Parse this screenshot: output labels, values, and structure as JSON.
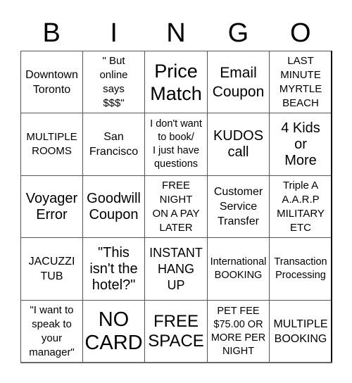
{
  "header": {
    "letters": [
      "B",
      "I",
      "N",
      "G",
      "O"
    ]
  },
  "board": {
    "cells": [
      [
        "Downtown\nToronto",
        "\" But\nonline\nsays\n$$$\"",
        "Price\nMatch",
        "Email\nCoupon",
        "LAST\nMINUTE\nMYRTLE\nBEACH"
      ],
      [
        "MULTIPLE\nROOMS",
        "San\nFrancisco",
        "I don't want\nto book/\nI just have\nquestions",
        "KUDOS\ncall",
        "4 Kids\nor\nMore"
      ],
      [
        "Voyager\nError",
        "Goodwill\nCoupon",
        "FREE\nNIGHT\nON A PAY\nLATER",
        "Customer\nService\nTransfer",
        "Triple A\nA.A.R.P\nMILITARY\nETC"
      ],
      [
        "JACUZZI\nTUB",
        "\"This\nisn't the\nhotel?\"",
        "INSTANT\nHANG\nUP",
        "International\nBOOKING",
        "Transaction\nProcessing"
      ],
      [
        "\"I want to\nspeak to\nyour\nmanager\"",
        "NO\nCARD",
        "FREE\nSPACE",
        "PET FEE\n$75.00 OR\nMORE PER\nNIGHT",
        "MULTIPLE\nBOOKING"
      ]
    ],
    "free_space_label": "FREE\nSPACE"
  },
  "colors": {
    "grid_line": "#555555",
    "text": "#000000",
    "background": "#ffffff"
  }
}
